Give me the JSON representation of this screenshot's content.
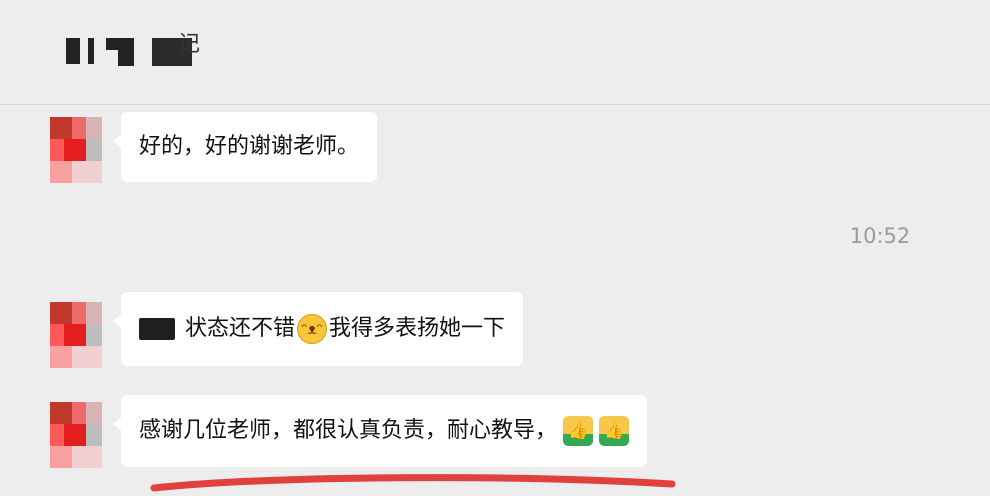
{
  "header": {
    "title_visible_fragment": "记"
  },
  "messages": [
    {
      "text": "好的，好的谢谢老师。"
    },
    {
      "time": "10:52"
    },
    {
      "text": "状态还不错",
      "emoji": "grinning-face-icon",
      "text_after": "我得多表扬她一下"
    },
    {
      "text": "感谢几位老师，都很认真负责，耐心教导，",
      "emoji": "thumbs-up-icon"
    }
  ],
  "colors": {
    "background": "#ededed",
    "bubble": "#ffffff",
    "time": "#9a9a9a",
    "highlight_underline": "#e0403e"
  }
}
